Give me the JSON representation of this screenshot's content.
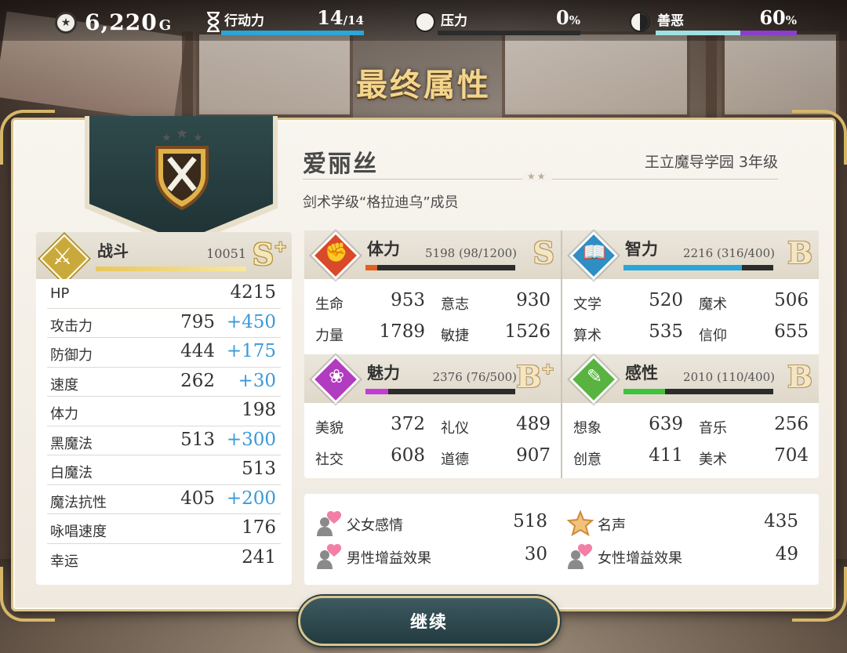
{
  "hud": {
    "gold": {
      "value": "6,220",
      "unit": "G"
    },
    "action": {
      "label": "行动力",
      "value": "14",
      "max": "/14",
      "fill": 1.0
    },
    "stress": {
      "label": "压力",
      "value": "0",
      "unit": "%",
      "fill": 0.0
    },
    "karma": {
      "label": "善恶",
      "value": "60",
      "unit": "%",
      "fill": 0.6
    }
  },
  "title": "最终属性",
  "character": {
    "name": "爱丽丝",
    "school": "王立魔导学园 3年级",
    "class": "剑术学级“格拉迪乌”成员"
  },
  "battle": {
    "label": "战斗",
    "value": "10051",
    "rank": "S",
    "rank_mod": "+",
    "stats": [
      {
        "name": "HP",
        "value": "4215",
        "bonus": ""
      },
      {
        "name": "攻击力",
        "value": "795",
        "bonus": "+450"
      },
      {
        "name": "防御力",
        "value": "444",
        "bonus": "+175"
      },
      {
        "name": "速度",
        "value": "262",
        "bonus": "+30"
      },
      {
        "name": "体力",
        "value": "198",
        "bonus": ""
      },
      {
        "name": "黑魔法",
        "value": "513",
        "bonus": "+300"
      },
      {
        "name": "白魔法",
        "value": "513",
        "bonus": ""
      },
      {
        "name": "魔法抗性",
        "value": "405",
        "bonus": "+200"
      },
      {
        "name": "咏唱速度",
        "value": "176",
        "bonus": ""
      },
      {
        "name": "幸运",
        "value": "241",
        "bonus": ""
      }
    ]
  },
  "attributes": [
    {
      "label": "体力",
      "value": "5198 (98/1200)",
      "rank": "S",
      "rank_mod": "",
      "fill": 0.08,
      "color": "#e1601e",
      "icon_color": "#d84a2a",
      "stats": [
        {
          "name": "生命",
          "value": "953"
        },
        {
          "name": "意志",
          "value": "930"
        },
        {
          "name": "力量",
          "value": "1789"
        },
        {
          "name": "敏捷",
          "value": "1526"
        }
      ]
    },
    {
      "label": "智力",
      "value": "2216 (316/400)",
      "rank": "B",
      "rank_mod": "",
      "fill": 0.79,
      "color": "#2aa6d9",
      "icon_color": "#2f8fc4",
      "stats": [
        {
          "name": "文学",
          "value": "520"
        },
        {
          "name": "魔术",
          "value": "506"
        },
        {
          "name": "算术",
          "value": "535"
        },
        {
          "name": "信仰",
          "value": "655"
        }
      ]
    },
    {
      "label": "魅力",
      "value": "2376 (76/500)",
      "rank": "B",
      "rank_mod": "+",
      "fill": 0.15,
      "color": "#c23dd3",
      "icon_color": "#b13cc0",
      "stats": [
        {
          "name": "美貌",
          "value": "372"
        },
        {
          "name": "礼仪",
          "value": "489"
        },
        {
          "name": "社交",
          "value": "608"
        },
        {
          "name": "道德",
          "value": "907"
        }
      ]
    },
    {
      "label": "感性",
      "value": "2010 (110/400)",
      "rank": "B",
      "rank_mod": "",
      "fill": 0.275,
      "color": "#3ec43a",
      "icon_color": "#58b340",
      "stats": [
        {
          "name": "想象",
          "value": "639"
        },
        {
          "name": "音乐",
          "value": "256"
        },
        {
          "name": "创意",
          "value": "411"
        },
        {
          "name": "美术",
          "value": "704"
        }
      ]
    }
  ],
  "relations": [
    {
      "name": "父女感情",
      "value": "518"
    },
    {
      "name": "名声",
      "value": "435"
    },
    {
      "name": "男性增益效果",
      "value": "30"
    },
    {
      "name": "女性增益效果",
      "value": "49"
    }
  ],
  "continue_label": "继续",
  "colors": {
    "hud_action": "#2aa6d9",
    "karma_good": "#9fe1e2",
    "karma_evil": "#8b3ec9",
    "bonus": "#3a9ad9",
    "title": "#f3d58c"
  }
}
